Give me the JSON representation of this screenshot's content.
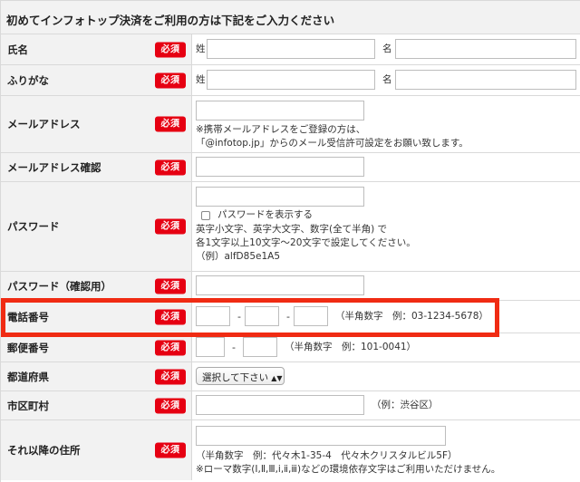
{
  "header": {
    "title": "初めてインフォトップ決済をご利用の方は下記をご入力ください"
  },
  "required_label": "必須",
  "name": {
    "label": "氏名",
    "last_prefix": "姓",
    "first_prefix": "名"
  },
  "furigana": {
    "label": "ふりがな",
    "last_prefix": "姓",
    "first_prefix": "名"
  },
  "email": {
    "label": "メールアドレス",
    "note_line1": "※携帯メールアドレスをご登録の方は、",
    "note_line2": "「@infotop.jp」からのメール受信許可設定をお願い致します。"
  },
  "email_confirm": {
    "label": "メールアドレス確認"
  },
  "password": {
    "label": "パスワード",
    "show_password_label": "パスワードを表示する",
    "note_line1": "英字小文字、英字大文字、数字(全て半角) で",
    "note_line2": "各1文字以上10文字〜20文字で設定してください。",
    "note_line3": "（例）alfD85e1A5"
  },
  "password_confirm": {
    "label": "パスワード（確認用）"
  },
  "phone": {
    "label": "電話番号",
    "sep1": "-",
    "sep2": "-",
    "hint": "（半角数字　例：03-1234-5678）"
  },
  "postal": {
    "label": "郵便番号",
    "sep": "-",
    "hint": "（半角数字　例：101-0041）"
  },
  "prefecture": {
    "label": "都道府県",
    "selected": "選択して下さい",
    "arrow": "▲▼"
  },
  "city": {
    "label": "市区町村",
    "hint": "（例：渋谷区）"
  },
  "address": {
    "label": "それ以降の住所",
    "hint_line1": "（半角数字　例：代々木1-35-4　代々木クリスタルビル5F）",
    "hint_line2": "※ローマ数字(Ⅰ,Ⅱ,Ⅲ,ⅰ,ⅱ,ⅲ)などの環境依存文字はご利用いただけません。"
  },
  "colors": {
    "required_bg": "#e60012",
    "highlight": "#f02b13",
    "label_bg": "#f2f2f2"
  }
}
